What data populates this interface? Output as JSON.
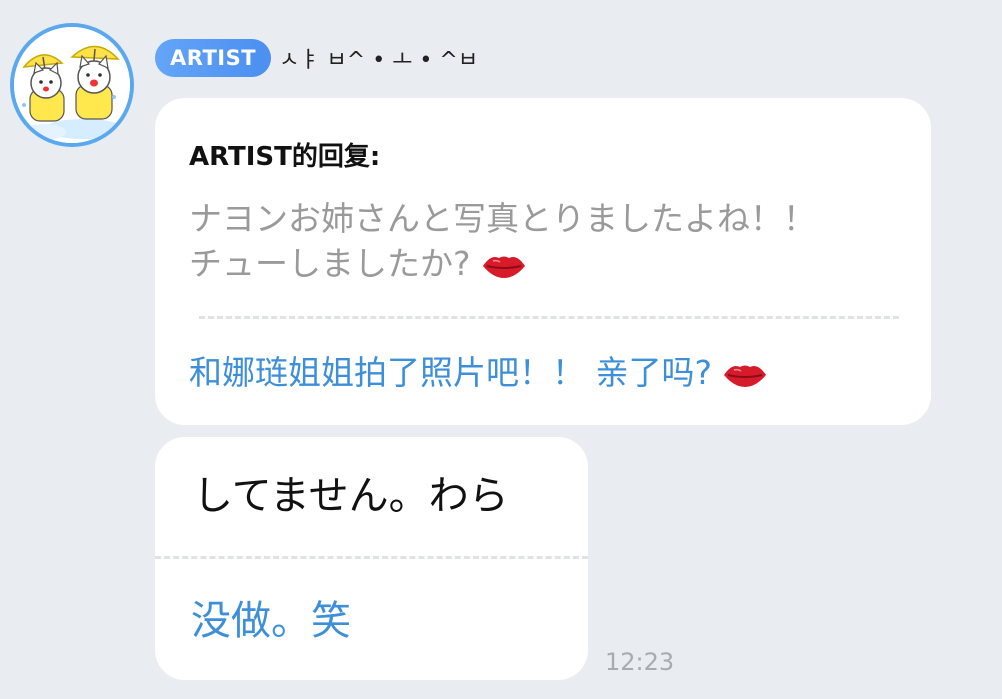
{
  "sender": {
    "badge": "ARTIST",
    "name": "ㅅㅑ ㅂ^ • ㅗ • ^ㅂ"
  },
  "messages": [
    {
      "reply_title": "ARTIST的回复:",
      "quoted_text": "ナヨンお姉さんと写真とりましたよね！！ チューしましたか?",
      "translation": "和娜琏姐姐拍了照片吧！！ 亲了吗?",
      "icon": "lips-icon"
    },
    {
      "text": "してません。わら",
      "translation": "没做。笑",
      "time": "12:23"
    }
  ],
  "colors": {
    "background": "#e9edf2",
    "badge": "#5b9cf4",
    "translation": "#3c8fd8",
    "quoted": "#9a9a9a"
  }
}
